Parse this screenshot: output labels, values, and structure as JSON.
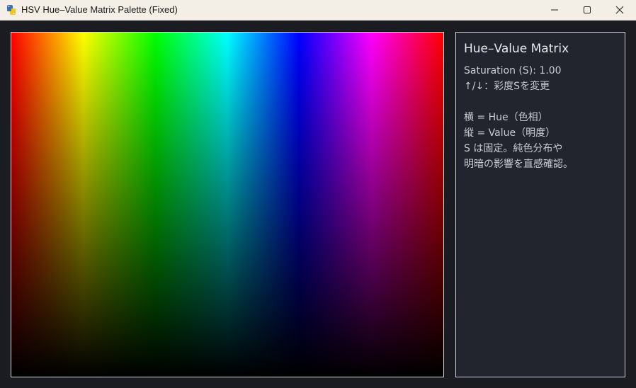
{
  "window": {
    "title": "HSV Hue–Value Matrix Palette (Fixed)",
    "icons": {
      "app": "python-icon",
      "minimize": "minimize-icon",
      "maximize": "maximize-icon",
      "close": "close-icon"
    }
  },
  "matrix": {
    "hue_colors": [
      "#ff0000",
      "#ffff00",
      "#00ff00",
      "#00ffff",
      "#0000ff",
      "#ff00ff",
      "#ff0000"
    ]
  },
  "panel": {
    "title": "Hue–Value Matrix",
    "saturation": "Saturation (S): 1.00",
    "hint": "↑/↓：彩度Sを変更",
    "blank": "",
    "desc1": "横 = Hue（色相）",
    "desc2": "縦 = Value（明度）",
    "desc3": "S は固定。純色分布や",
    "desc4": "明暗の影響を直感確認。"
  }
}
